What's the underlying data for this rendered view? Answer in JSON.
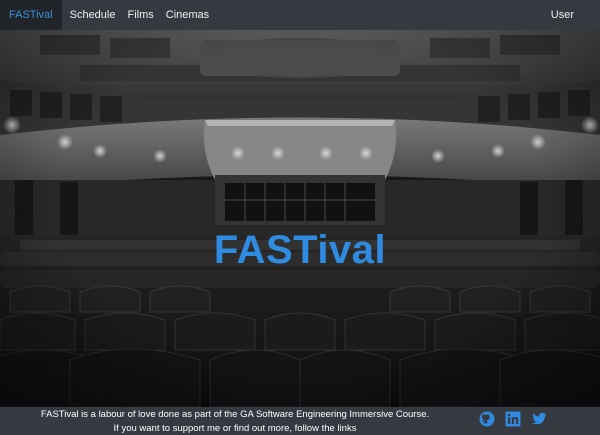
{
  "navbar": {
    "brand": "FASTival",
    "links": [
      "Schedule",
      "Films",
      "Cinemas"
    ],
    "user": "User"
  },
  "hero": {
    "title": "FASTival"
  },
  "footer": {
    "line1": "FASTival is a labour of love done as part of the GA Software Engineering Immersive Course.",
    "line2": "If you want to support me or find out more, follow the links",
    "icons": [
      "github-icon",
      "linkedin-icon",
      "twitter-icon"
    ]
  },
  "colors": {
    "accent": "#2f8be0",
    "navbar_bg": "#343a40",
    "brand_bg": "#212529"
  }
}
